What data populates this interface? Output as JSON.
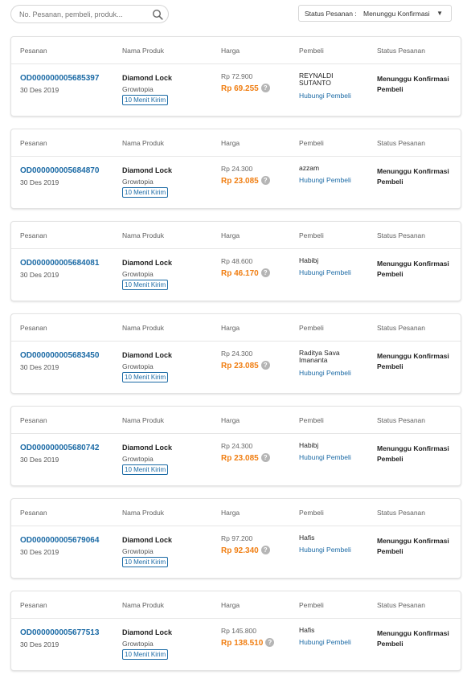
{
  "search": {
    "placeholder": "No. Pesanan, pembeli, produk..."
  },
  "filter": {
    "label": "Status Pesanan :",
    "value": "Menunggu Konfirmasi",
    "caret": "▼"
  },
  "columns": {
    "order": "Pesanan",
    "product": "Nama Produk",
    "price": "Harga",
    "buyer": "Pembeli",
    "status": "Status Pesanan"
  },
  "orders": [
    {
      "id": "OD000000005685397",
      "date": "30 Des 2019",
      "product": "Diamond Lock",
      "game": "Growtopia",
      "badge": "10 Menit Kirim",
      "price_original": "Rp 72.900",
      "price_net": "Rp 69.255",
      "buyer": "REYNALDI SUTANTO",
      "contact": "Hubungi Pembeli",
      "status": "Menunggu Konfirmasi Pembeli"
    },
    {
      "id": "OD000000005684870",
      "date": "30 Des 2019",
      "product": "Diamond Lock",
      "game": "Growtopia",
      "badge": "10 Menit Kirim",
      "price_original": "Rp 24.300",
      "price_net": "Rp 23.085",
      "buyer": "azzam",
      "contact": "Hubungi Pembeli",
      "status": "Menunggu Konfirmasi Pembeli"
    },
    {
      "id": "OD000000005684081",
      "date": "30 Des 2019",
      "product": "Diamond Lock",
      "game": "Growtopia",
      "badge": "10 Menit Kirim",
      "price_original": "Rp 48.600",
      "price_net": "Rp 46.170",
      "buyer": "Habibj",
      "contact": "Hubungi Pembeli",
      "status": "Menunggu Konfirmasi Pembeli"
    },
    {
      "id": "OD000000005683450",
      "date": "30 Des 2019",
      "product": "Diamond Lock",
      "game": "Growtopia",
      "badge": "10 Menit Kirim",
      "price_original": "Rp 24.300",
      "price_net": "Rp 23.085",
      "buyer": "Raditya Sava Imananta",
      "contact": "Hubungi Pembeli",
      "status": "Menunggu Konfirmasi Pembeli"
    },
    {
      "id": "OD000000005680742",
      "date": "30 Des 2019",
      "product": "Diamond Lock",
      "game": "Growtopia",
      "badge": "10 Menit Kirim",
      "price_original": "Rp 24.300",
      "price_net": "Rp 23.085",
      "buyer": "Habibj",
      "contact": "Hubungi Pembeli",
      "status": "Menunggu Konfirmasi Pembeli"
    },
    {
      "id": "OD000000005679064",
      "date": "30 Des 2019",
      "product": "Diamond Lock",
      "game": "Growtopia",
      "badge": "10 Menit Kirim",
      "price_original": "Rp 97.200",
      "price_net": "Rp 92.340",
      "buyer": "Hafis",
      "contact": "Hubungi Pembeli",
      "status": "Menunggu Konfirmasi Pembeli"
    },
    {
      "id": "OD000000005677513",
      "date": "30 Des 2019",
      "product": "Diamond Lock",
      "game": "Growtopia",
      "badge": "10 Menit Kirim",
      "price_original": "Rp 145.800",
      "price_net": "Rp 138.510",
      "buyer": "Hafis",
      "contact": "Hubungi Pembeli",
      "status": "Menunggu Konfirmasi Pembeli"
    }
  ],
  "help_glyph": "?",
  "colors": {
    "link": "#1b6aa5",
    "price": "#f07e12",
    "border": "#e2e2e2"
  },
  "icons": {
    "search": "search-icon",
    "help": "help-icon",
    "dropdown": "chevron-down-icon"
  }
}
